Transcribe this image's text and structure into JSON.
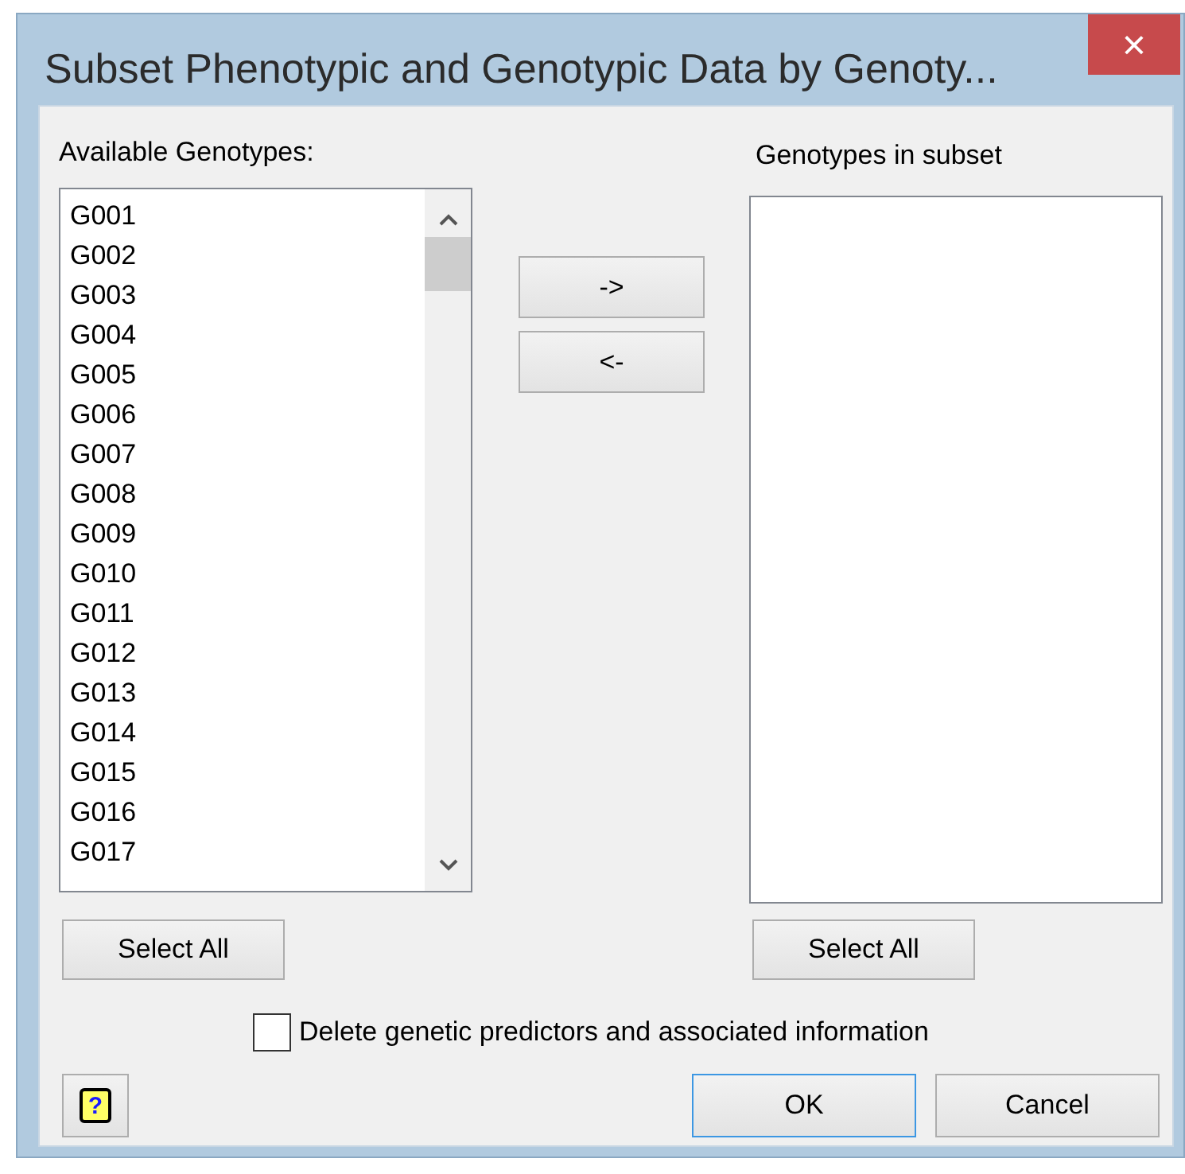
{
  "window": {
    "title": "Subset Phenotypic and Genotypic Data by Genoty...",
    "close": "×"
  },
  "available": {
    "label": "Available Genotypes:",
    "items": [
      {
        "text": "G001",
        "selected": false
      },
      {
        "text": "G002",
        "selected": false
      },
      {
        "text": "G003",
        "selected": false
      },
      {
        "text": "G004",
        "selected": false
      },
      {
        "text": "G005",
        "selected": false
      },
      {
        "text": "G006",
        "selected": false
      },
      {
        "text": "G007",
        "selected": false
      },
      {
        "text": "G008",
        "selected": false
      },
      {
        "text": "G009",
        "selected": false
      },
      {
        "text": "G010",
        "selected": false
      },
      {
        "text": "G011",
        "selected": false
      },
      {
        "text": "G012",
        "selected": false
      },
      {
        "text": "G013",
        "selected": false
      },
      {
        "text": "G014",
        "selected": false
      },
      {
        "text": "G015",
        "selected": false
      },
      {
        "text": "G016",
        "selected": false
      },
      {
        "text": "G017",
        "selected": false
      }
    ],
    "select_all": "Select All"
  },
  "move_buttons": [
    "->",
    "<-"
  ],
  "subset": {
    "label": "Genotypes in subset",
    "select_all": "Select All"
  },
  "delete_option": {
    "label": "Delete genetic predictors and associated information",
    "checked": false
  },
  "help_button": "?",
  "buttons": [
    {
      "label": "OK",
      "focused": true
    },
    {
      "label": "Cancel",
      "focused": false
    }
  ]
}
